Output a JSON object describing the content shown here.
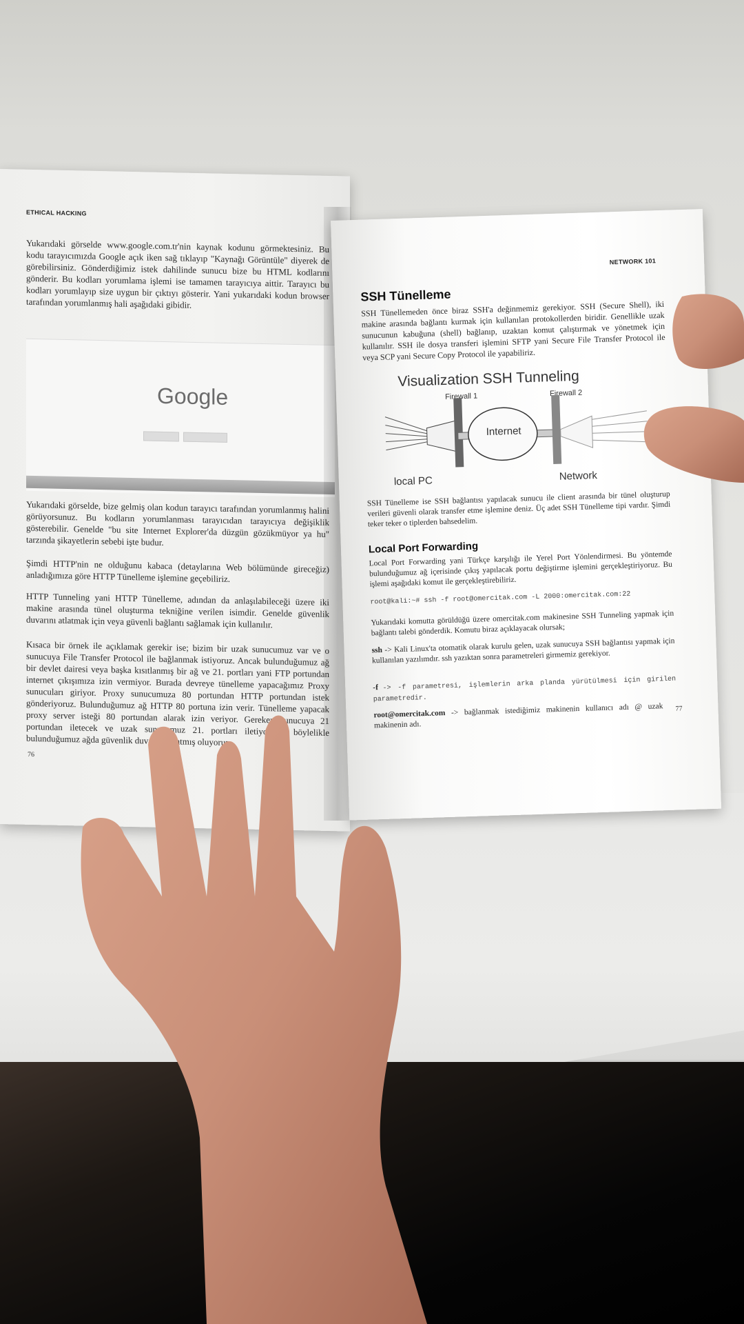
{
  "left_page": {
    "running_head": "ETHICAL HACKING",
    "para1": "Yukarıdaki görselde www.google.com.tr'nin kaynak kodunu görmektesiniz. Bu kodu tarayıcımızda Google açık iken sağ tıklayıp \"Kaynağı Görüntüle\" diyerek de görebilirsiniz. Gönderdiğimiz istek dahilinde sunucu bize bu HTML kodlarını gönderir. Bu kodları yorumlama işlemi ise tamamen tarayıcıya aittir. Tarayıcı bu kodları yorumlayıp size uygun bir çıktıyı gösterir. Yani yukarıdaki kodun browser tarafından yorumlanmış hali aşağıdaki gibidir.",
    "screenshot_logo": "Google",
    "para2": "Yukarıdaki görselde, bize gelmiş olan kodun tarayıcı tarafından yorumlanmış halini görüyorsunuz. Bu kodların yorumlanması tarayıcıdan tarayıcıya değişiklik gösterebilir. Genelde \"bu site Internet Explorer'da düzgün gözükmüyor ya hu\" tarzında şikayetlerin sebebi işte budur.",
    "para3": "Şimdi HTTP'nin ne olduğunu kabaca (detaylarına Web bölümünde gireceğiz) anladığımıza göre HTTP Tünelleme işlemine geçebiliriz.",
    "para4": "HTTP Tunneling yani HTTP Tünelleme, adından da anlaşılabileceği üzere iki makine arasında tünel oluşturma tekniğine verilen isimdir. Genelde güvenlik duvarını atlatmak için veya güvenli bağlantı sağlamak için kullanılır.",
    "para5": "Kısaca bir örnek ile açıklamak gerekir ise; bizim bir uzak sunucumuz var ve o sunucuya File Transfer Protocol ile bağlanmak istiyoruz. Ancak bulunduğumuz ağ bir devlet dairesi veya başka kısıtlanmış bir ağ ve 21. portları yani FTP portundan internet çıkışımıza izin vermiyor. Burada devreye tünelleme yapacağımız Proxy sunucuları giriyor. Proxy sunucumuza 80 portundan HTTP portundan istek gönderiyoruz. Bulunduğumuz ağ HTTP 80 portuna izin verir. Tünelleme yapacak proxy server isteği 80 portundan alarak izin veriyor. Gereken sunucuya 21 portundan iletecek ve uzak sunucumuz 21. portları iletiyor ve böylelikle bulunduğumuz ağda güvenlik duvarını atlatmış oluyoruz.",
    "page_number": "76"
  },
  "right_page": {
    "running_head": "NETWORK 101",
    "heading_ssh": "SSH Tünelleme",
    "para1": "SSH Tünellemeden önce biraz SSH'a değinmemiz gerekiyor. SSH (Secure Shell), iki makine arasında bağlantı kurmak için kullanılan protokollerden biridir. Genellikle uzak sunucunun kabuğuna (shell) bağlanıp, uzaktan komut çalıştırmak ve yönetmek için kullanılır. SSH ile dosya transferi işlemini SFTP yani Secure File Transfer Protocol ile veya SCP yani Secure Copy Protocol ile yapabiliriz.",
    "diagram": {
      "title": "Visualization SSH Tunneling",
      "firewall1": "Firewall 1",
      "firewall2": "Firewall 2",
      "cloud": "Internet",
      "local": "local PC",
      "network": "Network"
    },
    "para2": "SSH Tünelleme ise SSH bağlantısı yapılacak sunucu ile client arasında bir tünel oluşturup verileri güvenli olarak transfer etme işlemine deniz. Üç adet SSH Tünelleme tipi vardır. Şimdi teker teker o tiplerden bahsedelim.",
    "heading_lpf": "Local Port Forwarding",
    "para3": "Local Port Forwarding yani Türkçe karşılığı ile Yerel Port Yönlendirmesi. Bu yöntemde bulunduğumuz ağ içerisinde çıkış yapılacak portu değiştirme işlemini gerçekleştiriyoruz. Bu işlemi aşağıdaki komut ile gerçekleştirebiliriz.",
    "command": "root@kali:~# ssh -f root@omercitak.com -L 2000:omercitak.com:22",
    "para4": "Yukarıdaki komutta görüldüğü üzere omercitak.com makinesine SSH Tunneling yapmak için bağlantı talebi gönderdik. Komutu biraz açıklayacak olursak;",
    "ssh_term": "ssh",
    "para5": "-> Kali Linux'ta otomatik olarak kurulu gelen, uzak sunucuya SSH bağlantısı yapmak için kullanılan yazılımdır. ssh yazıktan sonra parametreleri girmemiz gerekiyor.",
    "f_term": "-f",
    "para6": "-> -f parametresi, işlemlerin arka planda yürütülmesi için girilen parametredir.",
    "root_term": "root@omercitak.com",
    "para7": "-> bağlanmak istediğimiz makinenin kullanıcı adı @ uzak makinenin adı.",
    "page_number": "77"
  },
  "colors": {
    "paper": "#f4f4f2",
    "ink": "#2a2a2a",
    "skin": "#c98f78",
    "table_dark": "#0b0b0b"
  }
}
